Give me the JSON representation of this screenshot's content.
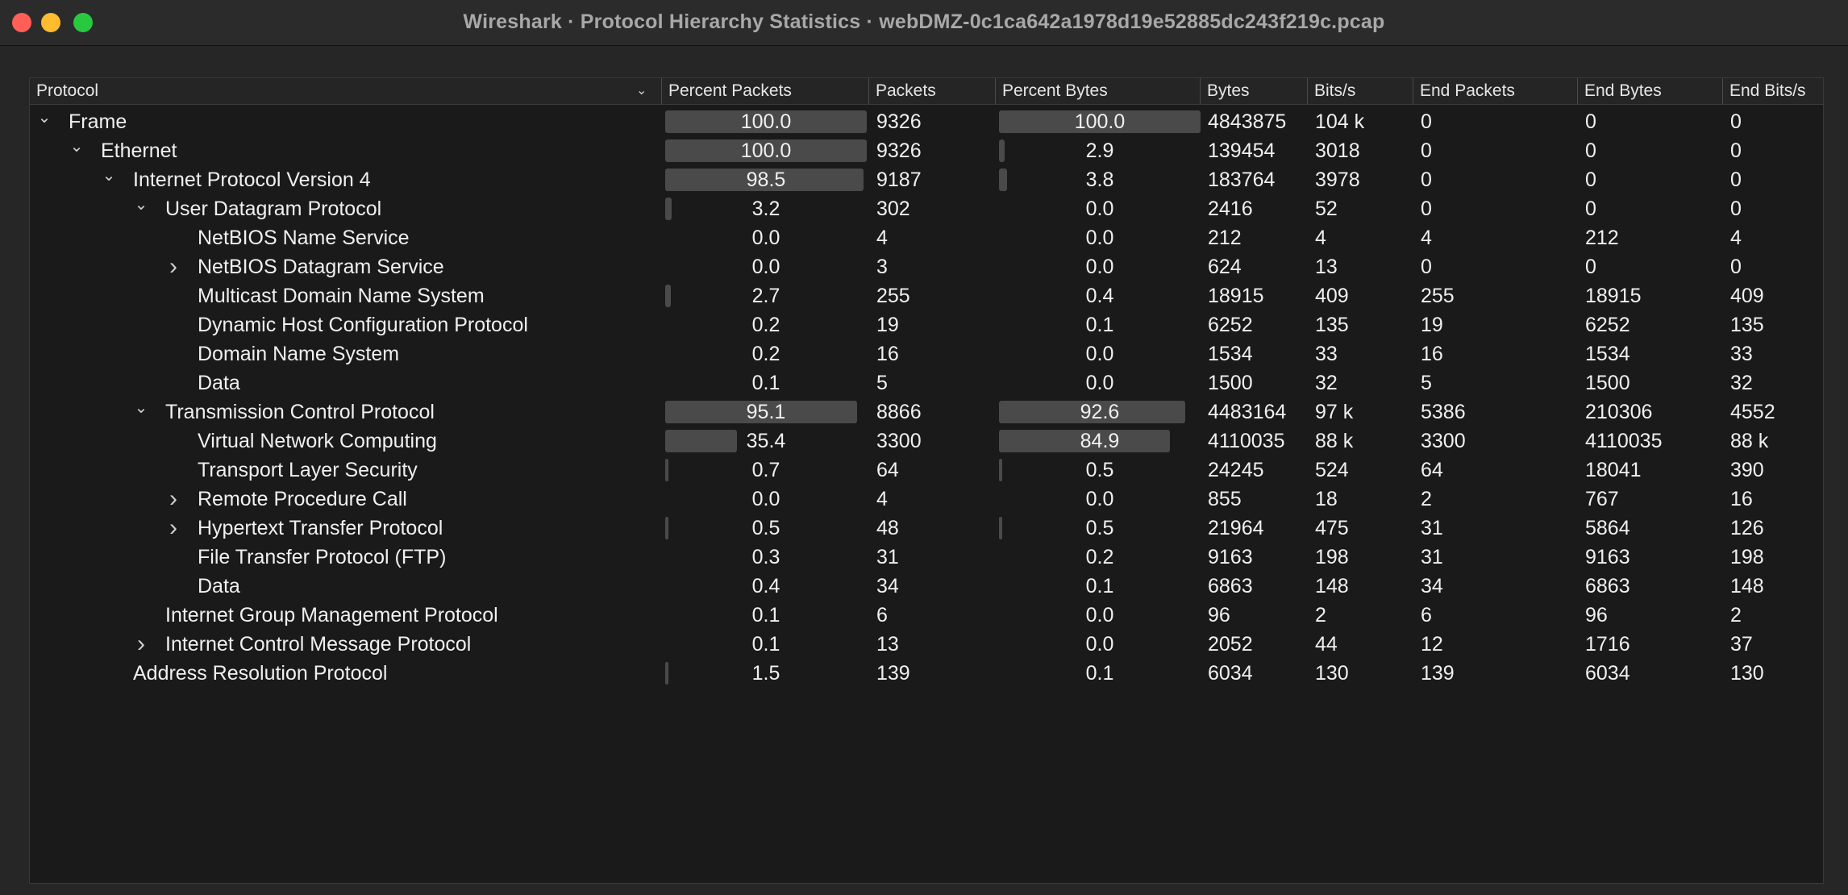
{
  "window": {
    "title": "Wireshark · Protocol Hierarchy Statistics · webDMZ-0c1ca642a1978d19e52885dc243f219c.pcap"
  },
  "columns": [
    "Protocol",
    "Percent Packets",
    "Packets",
    "Percent Bytes",
    "Bytes",
    "Bits/s",
    "End Packets",
    "End Bytes",
    "End Bits/s"
  ],
  "sort_icon": "chevron-down-icon",
  "rows": [
    {
      "name": "Frame",
      "depth": 0,
      "toggle": "expanded",
      "pp": "100.0",
      "packets": "9326",
      "pb": "100.0",
      "bytes": "4843875",
      "bits": "104 k",
      "ep": "0",
      "eb": "0",
      "ebits": "0"
    },
    {
      "name": "Ethernet",
      "depth": 1,
      "toggle": "expanded",
      "pp": "100.0",
      "packets": "9326",
      "pb": "2.9",
      "bytes": "139454",
      "bits": "3018",
      "ep": "0",
      "eb": "0",
      "ebits": "0"
    },
    {
      "name": "Internet Protocol Version 4",
      "depth": 2,
      "toggle": "expanded",
      "pp": "98.5",
      "packets": "9187",
      "pb": "3.8",
      "bytes": "183764",
      "bits": "3978",
      "ep": "0",
      "eb": "0",
      "ebits": "0"
    },
    {
      "name": "User Datagram Protocol",
      "depth": 3,
      "toggle": "expanded",
      "pp": "3.2",
      "packets": "302",
      "pb": "0.0",
      "bytes": "2416",
      "bits": "52",
      "ep": "0",
      "eb": "0",
      "ebits": "0"
    },
    {
      "name": "NetBIOS Name Service",
      "depth": 4,
      "toggle": "none",
      "pp": "0.0",
      "packets": "4",
      "pb": "0.0",
      "bytes": "212",
      "bits": "4",
      "ep": "4",
      "eb": "212",
      "ebits": "4"
    },
    {
      "name": "NetBIOS Datagram Service",
      "depth": 4,
      "toggle": "collapsed",
      "pp": "0.0",
      "packets": "3",
      "pb": "0.0",
      "bytes": "624",
      "bits": "13",
      "ep": "0",
      "eb": "0",
      "ebits": "0"
    },
    {
      "name": "Multicast Domain Name System",
      "depth": 4,
      "toggle": "none",
      "pp": "2.7",
      "packets": "255",
      "pb": "0.4",
      "bytes": "18915",
      "bits": "409",
      "ep": "255",
      "eb": "18915",
      "ebits": "409"
    },
    {
      "name": "Dynamic Host Configuration Protocol",
      "depth": 4,
      "toggle": "none",
      "pp": "0.2",
      "packets": "19",
      "pb": "0.1",
      "bytes": "6252",
      "bits": "135",
      "ep": "19",
      "eb": "6252",
      "ebits": "135"
    },
    {
      "name": "Domain Name System",
      "depth": 4,
      "toggle": "none",
      "pp": "0.2",
      "packets": "16",
      "pb": "0.0",
      "bytes": "1534",
      "bits": "33",
      "ep": "16",
      "eb": "1534",
      "ebits": "33"
    },
    {
      "name": "Data",
      "depth": 4,
      "toggle": "none",
      "pp": "0.1",
      "packets": "5",
      "pb": "0.0",
      "bytes": "1500",
      "bits": "32",
      "ep": "5",
      "eb": "1500",
      "ebits": "32"
    },
    {
      "name": "Transmission Control Protocol",
      "depth": 3,
      "toggle": "expanded",
      "pp": "95.1",
      "packets": "8866",
      "pb": "92.6",
      "bytes": "4483164",
      "bits": "97 k",
      "ep": "5386",
      "eb": "210306",
      "ebits": "4552"
    },
    {
      "name": "Virtual Network Computing",
      "depth": 4,
      "toggle": "none",
      "pp": "35.4",
      "packets": "3300",
      "pb": "84.9",
      "bytes": "4110035",
      "bits": "88 k",
      "ep": "3300",
      "eb": "4110035",
      "ebits": "88 k"
    },
    {
      "name": "Transport Layer Security",
      "depth": 4,
      "toggle": "none",
      "pp": "0.7",
      "packets": "64",
      "pb": "0.5",
      "bytes": "24245",
      "bits": "524",
      "ep": "64",
      "eb": "18041",
      "ebits": "390"
    },
    {
      "name": "Remote Procedure Call",
      "depth": 4,
      "toggle": "collapsed",
      "pp": "0.0",
      "packets": "4",
      "pb": "0.0",
      "bytes": "855",
      "bits": "18",
      "ep": "2",
      "eb": "767",
      "ebits": "16"
    },
    {
      "name": "Hypertext Transfer Protocol",
      "depth": 4,
      "toggle": "collapsed",
      "pp": "0.5",
      "packets": "48",
      "pb": "0.5",
      "bytes": "21964",
      "bits": "475",
      "ep": "31",
      "eb": "5864",
      "ebits": "126"
    },
    {
      "name": "File Transfer Protocol (FTP)",
      "depth": 4,
      "toggle": "none",
      "pp": "0.3",
      "packets": "31",
      "pb": "0.2",
      "bytes": "9163",
      "bits": "198",
      "ep": "31",
      "eb": "9163",
      "ebits": "198"
    },
    {
      "name": "Data",
      "depth": 4,
      "toggle": "none",
      "pp": "0.4",
      "packets": "34",
      "pb": "0.1",
      "bytes": "6863",
      "bits": "148",
      "ep": "34",
      "eb": "6863",
      "ebits": "148"
    },
    {
      "name": "Internet Group Management Protocol",
      "depth": 3,
      "toggle": "none",
      "pp": "0.1",
      "packets": "6",
      "pb": "0.0",
      "bytes": "96",
      "bits": "2",
      "ep": "6",
      "eb": "96",
      "ebits": "2"
    },
    {
      "name": "Internet Control Message Protocol",
      "depth": 3,
      "toggle": "collapsed",
      "pp": "0.1",
      "packets": "13",
      "pb": "0.0",
      "bytes": "2052",
      "bits": "44",
      "ep": "12",
      "eb": "1716",
      "ebits": "37"
    },
    {
      "name": "Address Resolution Protocol",
      "depth": 2,
      "toggle": "none",
      "pp": "1.5",
      "packets": "139",
      "pb": "0.1",
      "bytes": "6034",
      "bits": "130",
      "ep": "139",
      "eb": "6034",
      "ebits": "130"
    }
  ]
}
